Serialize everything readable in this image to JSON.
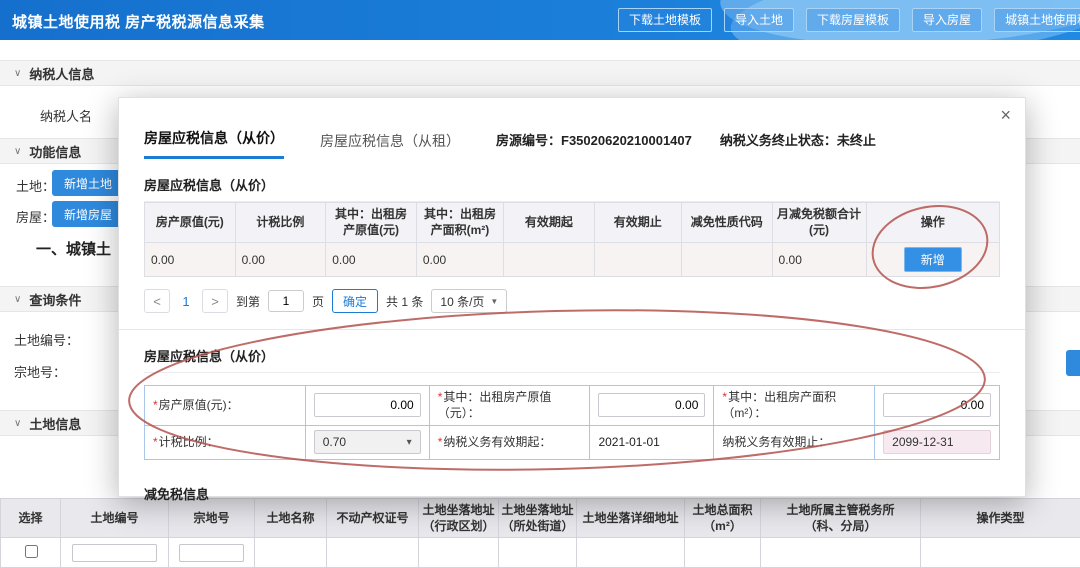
{
  "colors": {
    "header_blue": "#1777d3",
    "accent_blue": "#2f8ade",
    "annotation_red": "#b4524e",
    "readonly_pink": "#f6e9ef"
  },
  "icons": {
    "caret": "∨",
    "close": "×",
    "prev": "<",
    "next": ">",
    "dropdown": "▼",
    "select_caret": "▾"
  },
  "header": {
    "title": "城镇土地使用税 房产税税源信息采集",
    "buttons": [
      {
        "label": "下载土地模板"
      },
      {
        "label": "导入土地"
      },
      {
        "label": "下载房屋模板"
      },
      {
        "label": "导入房屋"
      },
      {
        "label": "城镇土地使用税 房产"
      }
    ]
  },
  "page": {
    "sections": {
      "taxpayer": "纳税人信息",
      "function": "功能信息",
      "query": "查询条件",
      "land": "土地信息"
    },
    "taxpayer_name_label": "纳税人名",
    "land_row_label": "土地：",
    "land_add_button": "新增土地",
    "house_row_label": "房屋：",
    "house_add_button": "新增房屋",
    "main_heading": "一、城镇土",
    "land_no_label": "土地编号：",
    "parcel_no_label": "宗地号：",
    "land_table": {
      "headers": [
        "选择",
        "土地编号",
        "宗地号",
        "土地名称",
        "不动产权证号",
        "土地坐落地址\n（行政区划）",
        "土地坐落地址\n（所处街道）",
        "土地坐落详细地址",
        "土地总面积\n（m²）",
        "土地所属主管税务所\n（科、分局）",
        "操作类型"
      ]
    }
  },
  "modal": {
    "tabs": [
      {
        "label": "房屋应税信息（从价）"
      },
      {
        "label": "房屋应税信息（从租）"
      }
    ],
    "house_code_label": "房源编号：",
    "house_code_value": "F35020620210001407",
    "status_label": "纳税义务终止状态：",
    "status_value": "未终止",
    "table_section_title": "房屋应税信息（从价）",
    "table": {
      "headers": [
        "房产原值(元)",
        "计税比例",
        "其中：出租房产原值(元)",
        "其中：出租房产面积(m²)",
        "有效期起",
        "有效期止",
        "减免性质代码",
        "月减免税额合计(元)",
        "操作"
      ],
      "row": [
        "0.00",
        "0.00",
        "0.00",
        "0.00",
        "",
        "",
        "",
        "0.00"
      ],
      "add_button": "新增"
    },
    "pagination": {
      "current_page": "1",
      "goto_label": "到第",
      "goto_value": "1",
      "goto_unit": "页",
      "confirm_button": "确定",
      "total_text": "共 1 条",
      "page_size": "10 条/页"
    },
    "form_section_title": "房屋应税信息（从价）",
    "form": {
      "required_mark": "*",
      "original_value": {
        "label": "房产原值(元)：",
        "value": "0.00"
      },
      "rented_value": {
        "label": "其中：出租房产原值（元）：",
        "value": "0.00"
      },
      "rented_area": {
        "label": "其中：出租房产面积（m²）：",
        "value": "0.00"
      },
      "tax_ratio": {
        "label": "计税比例：",
        "value": "0.70"
      },
      "valid_from": {
        "label": "纳税义务有效期起：",
        "value": "2021-01-01"
      },
      "valid_to": {
        "label": "纳税义务有效期止：",
        "value": "2099-12-31"
      }
    },
    "reduction_section_title": "减免税信息"
  }
}
